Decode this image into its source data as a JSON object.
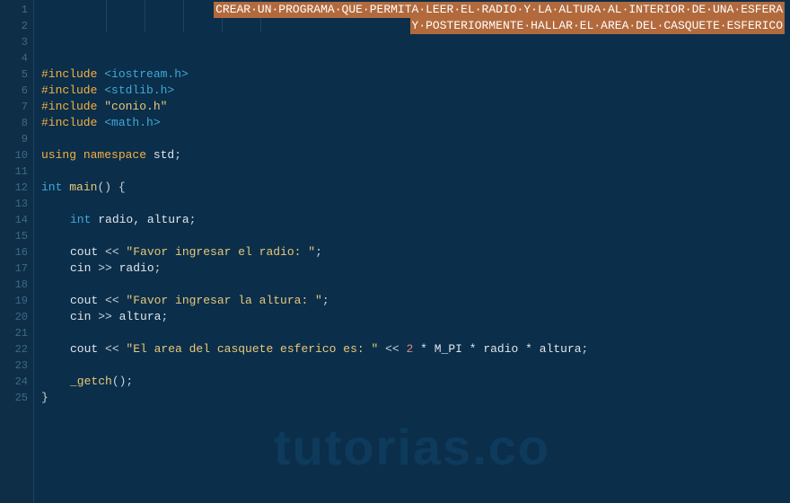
{
  "watermark": "tutorias.co",
  "gutter": [
    "1",
    "2",
    "3",
    "4",
    "5",
    "6",
    "7",
    "8",
    "9",
    "10",
    "11",
    "12",
    "13",
    "14",
    "15",
    "16",
    "17",
    "18",
    "19",
    "20",
    "21",
    "22",
    "23",
    "24",
    "25"
  ],
  "sel": {
    "line1": "CREAR·UN·PROGRAMA·QUE·PERMITA·LEER·EL·RADIO·Y·LA·ALTURA·AL·INTERIOR·DE·UNA·ESFERA",
    "line2": "Y·POSTERIORMENTE·HALLAR·EL·AREA·DEL·CASQUETE·ESFERICO"
  },
  "code": {
    "l5": {
      "pp": "#include ",
      "inc": "<iostream.h>"
    },
    "l6": {
      "pp": "#include ",
      "inc": "<stdlib.h>"
    },
    "l7": {
      "pp": "#include ",
      "str": "\"conio.h\""
    },
    "l8": {
      "pp": "#include ",
      "inc": "<math.h>"
    },
    "l10": {
      "kw1": "using ",
      "kw2": "namespace ",
      "id": "std",
      "semi": ";"
    },
    "l12": {
      "type": "int ",
      "fn": "main",
      "paren": "() {"
    },
    "l14": {
      "type": "int ",
      "ids": "radio, altura",
      "semi": ";"
    },
    "l16": {
      "id": "cout ",
      "op": "<< ",
      "str": "\"Favor ingresar el radio: \"",
      "semi": ";"
    },
    "l17": {
      "id": "cin ",
      "op": ">> ",
      "var": "radio",
      "semi": ";"
    },
    "l19": {
      "id": "cout ",
      "op": "<< ",
      "str": "\"Favor ingresar la altura: \"",
      "semi": ";"
    },
    "l20": {
      "id": "cin ",
      "op": ">> ",
      "var": "altura",
      "semi": ";"
    },
    "l22": {
      "id": "cout ",
      "op1": "<< ",
      "str": "\"El area del casquete esferico es: \"",
      "op2": " << ",
      "num": "2",
      "rest": " * M_PI * radio * altura",
      "semi": ";"
    },
    "l24": {
      "fn": "_getch",
      "paren": "()",
      "semi": ";"
    },
    "l25": "}"
  }
}
